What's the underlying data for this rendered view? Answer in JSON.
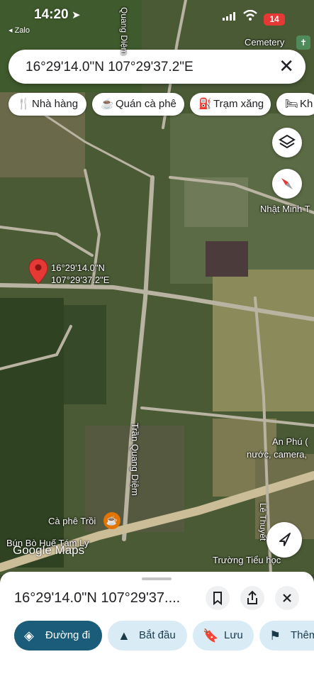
{
  "status_bar": {
    "time": "14:20",
    "back_label": "◂ Zalo",
    "battery": "14"
  },
  "search": {
    "query": "16°29'14.0\"N 107°29'37.2\"E",
    "clear_glyph": "✕"
  },
  "chips": [
    {
      "icon": "🍴",
      "label": "Nhà hàng"
    },
    {
      "icon": "☕",
      "label": "Quán cà phê"
    },
    {
      "icon": "⛽",
      "label": "Trạm xăng"
    },
    {
      "icon": "🛏",
      "label": "Kh"
    }
  ],
  "map": {
    "pin_label_line1": "16°29'14.0\"N",
    "pin_label_line2": "107°29'37.2\"E",
    "labels": {
      "cemetery": "Cemetery",
      "nhat_minh": "Nhật Minh T",
      "an_phu_1": "An Phú (",
      "an_phu_2": "nước, camera, ",
      "road_tran_quang_diem": "Trần Quang Diệm",
      "road_quang_diem_top": "Quang Diệm",
      "road_le_thuyet": "Lê Thuyết",
      "ca_phe_troi": "Cà phê Trồi",
      "bun_bo": "Bún Bò Huế Tám Ly",
      "truong": "Trường Tiểu học",
      "google": "Google Maps"
    }
  },
  "sheet": {
    "title": "16°29'14.0\"N 107°29'37....",
    "actions": [
      {
        "icon": "◈",
        "label": "Đường đi"
      },
      {
        "icon": "▲",
        "label": "Bắt đầu"
      },
      {
        "icon": "🔖",
        "label": "Lưu"
      },
      {
        "icon": "⚑",
        "label": "Thêm"
      }
    ]
  },
  "colors": {
    "primary": "#0b57d0",
    "primary_dark": "#1a5c7a",
    "chip_bg": "#ffffff",
    "action_bg": "#d3e3fd",
    "pin": "#e53935"
  }
}
